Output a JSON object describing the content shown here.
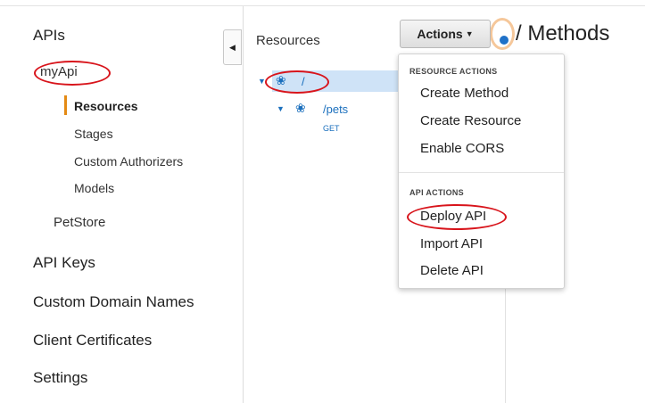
{
  "nav": {
    "apis": "APIs",
    "api_name": "myApi",
    "sub_items": [
      "Resources",
      "Stages",
      "Custom Authorizers",
      "Models"
    ],
    "petstore": "PetStore",
    "api_keys": "API Keys",
    "custom_domain_names": "Custom Domain Names",
    "client_certificates": "Client Certificates",
    "settings": "Settings"
  },
  "resources": {
    "title": "Resources",
    "root_path": "/",
    "child_path": "/pets",
    "child_method": "GET"
  },
  "actions": {
    "label": "Actions",
    "resource_section": "RESOURCE ACTIONS",
    "resource_items": [
      "Create Method",
      "Create Resource",
      "Enable CORS"
    ],
    "api_section": "API ACTIONS",
    "api_items": [
      "Deploy API",
      "Import API",
      "Delete API"
    ]
  },
  "methods": {
    "title": "/ Methods"
  },
  "colors": {
    "annotation": "#d8141b",
    "link": "#1a6fbd",
    "active_marker": "#e48a14",
    "selected_row": "#cfe3f7"
  }
}
